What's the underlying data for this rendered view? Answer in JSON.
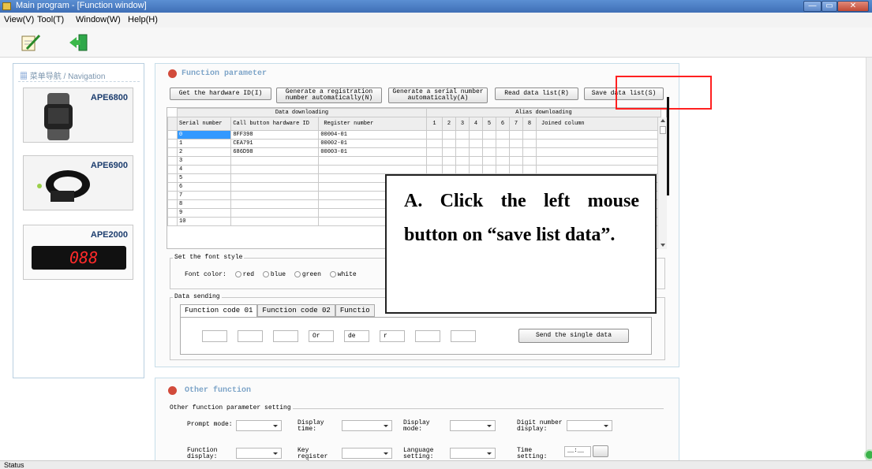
{
  "window": {
    "title": "Main program - [Function window]",
    "min": "—",
    "max": "▭",
    "close": "✕"
  },
  "menu": [
    "View(V)",
    "Tool(T)",
    "Window(W)",
    "Help(H)"
  ],
  "nav": {
    "title_zh": "菜单导航",
    "title_sep": " / ",
    "title_en": "Navigation",
    "devices": [
      {
        "label": "APE6800",
        "icon": "watch-icon"
      },
      {
        "label": "APE6900",
        "icon": "wristband-icon"
      },
      {
        "label": "APE2000",
        "icon": "display-icon",
        "screen": "088"
      }
    ]
  },
  "function_param": {
    "title": "Function parameter",
    "buttons": [
      "Get the hardware ID(I)",
      "Generate a registration number automatically(N)",
      "Generate a serial number automatically(A)",
      "Read data list(R)",
      "Save data list(S)"
    ],
    "group_headers": [
      "Data downloading",
      "Alias downloading"
    ],
    "columns": [
      "Serial number",
      "Call button hardware ID",
      "Register number",
      "1",
      "2",
      "3",
      "4",
      "5",
      "6",
      "7",
      "8",
      "Joined column"
    ],
    "rows": [
      [
        "0",
        "8FF398",
        "00004-01"
      ],
      [
        "1",
        "CEA791",
        "00002-01"
      ],
      [
        "2",
        "686D98",
        "00003-01"
      ],
      [
        "3",
        "",
        ""
      ],
      [
        "4",
        "",
        ""
      ],
      [
        "5",
        "",
        ""
      ],
      [
        "6",
        "",
        ""
      ],
      [
        "7",
        "",
        ""
      ],
      [
        "8",
        "",
        ""
      ],
      [
        "9",
        "",
        ""
      ],
      [
        "10",
        "",
        ""
      ]
    ]
  },
  "font_style": {
    "caption": "Set the font style",
    "label": "Font color:",
    "options": [
      "red",
      "blue",
      "green",
      "white"
    ]
  },
  "data_sending": {
    "caption": "Data sending",
    "tabs": [
      "Function code 01",
      "Function code 02",
      "Functio"
    ],
    "fields": [
      "",
      "",
      "",
      "Or",
      "de",
      "r",
      "",
      ""
    ],
    "send": "Send the single data"
  },
  "callout": {
    "text": "A. Click the left mouse button on “save list data”."
  },
  "other": {
    "title": "Other function",
    "caption": "Other function parameter setting",
    "labels": [
      "Prompt mode:",
      "Display time:",
      "Display mode:",
      "Digit number display:",
      "Function display:",
      "Key register mode:",
      "Language setting:",
      "Time setting:"
    ],
    "time_value": "__:__"
  },
  "status": "Status",
  "colors": {
    "highlight_box": "#ff2020",
    "selected_cell": "#3399ff",
    "title_bar": "#4a7cc2"
  }
}
